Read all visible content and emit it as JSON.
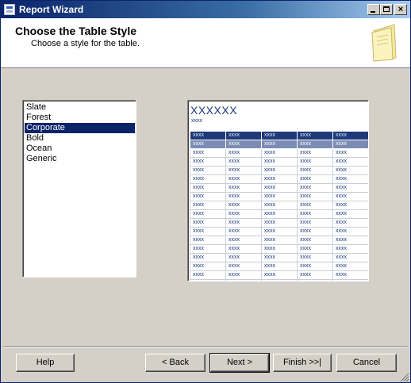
{
  "window": {
    "title": "Report Wizard",
    "controls": {
      "minimize": "minimize",
      "maximize": "maximize",
      "close": "×"
    }
  },
  "header": {
    "title": "Choose the Table Style",
    "subtitle": "Choose a style for the table."
  },
  "styles": {
    "items": [
      "Slate",
      "Forest",
      "Corporate",
      "Bold",
      "Ocean",
      "Generic"
    ],
    "selected": "Corporate"
  },
  "preview": {
    "title": "XXXXXX",
    "subtitle": "xxxx",
    "cell_text": "xxxx",
    "columns": 5,
    "rows": 18,
    "colors": {
      "header": "#1f3a7a",
      "highlight_row": "#7b8bb3",
      "text": "#1f3a7a"
    }
  },
  "buttons": {
    "help": "Help",
    "back": "< Back",
    "next": "Next >",
    "finish": "Finish >>|",
    "cancel": "Cancel"
  },
  "icons": {
    "app": "report-wizard-icon",
    "header": "notepad-icon"
  }
}
